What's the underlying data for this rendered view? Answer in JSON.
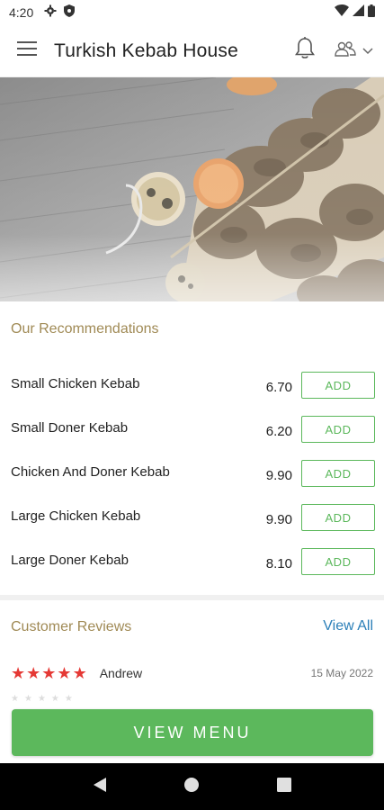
{
  "status_bar": {
    "time": "4:20",
    "icons": [
      "settings-icon",
      "shield-icon",
      "wifi-icon",
      "signal-icon",
      "battery-icon"
    ]
  },
  "app_bar": {
    "title": "Turkish Kebab House",
    "icons": [
      "menu-icon",
      "bell-icon",
      "user-group-icon",
      "chevron-down-icon"
    ]
  },
  "recommendations": {
    "title": "Our Recommendations",
    "add_label": "ADD",
    "items": [
      {
        "name": "Small Chicken Kebab",
        "price": "6.70"
      },
      {
        "name": "Small Doner Kebab",
        "price": "6.20"
      },
      {
        "name": "Chicken And Doner Kebab",
        "price": "9.90"
      },
      {
        "name": "Large Chicken Kebab",
        "price": "9.90"
      },
      {
        "name": "Large Doner Kebab",
        "price": "8.10"
      }
    ]
  },
  "reviews": {
    "title": "Customer Reviews",
    "view_all": "View All",
    "items": [
      {
        "rating": 5,
        "name": "Andrew",
        "date": "15 May 2022"
      }
    ]
  },
  "view_menu_label": "VIEW MENU",
  "colors": {
    "accent_green": "#5cb85c",
    "section_title": "#a08a55",
    "link_blue": "#2b7fb8",
    "star_red": "#e53935"
  },
  "nav": {
    "icons": [
      "back-icon",
      "home-icon",
      "recents-icon"
    ]
  }
}
